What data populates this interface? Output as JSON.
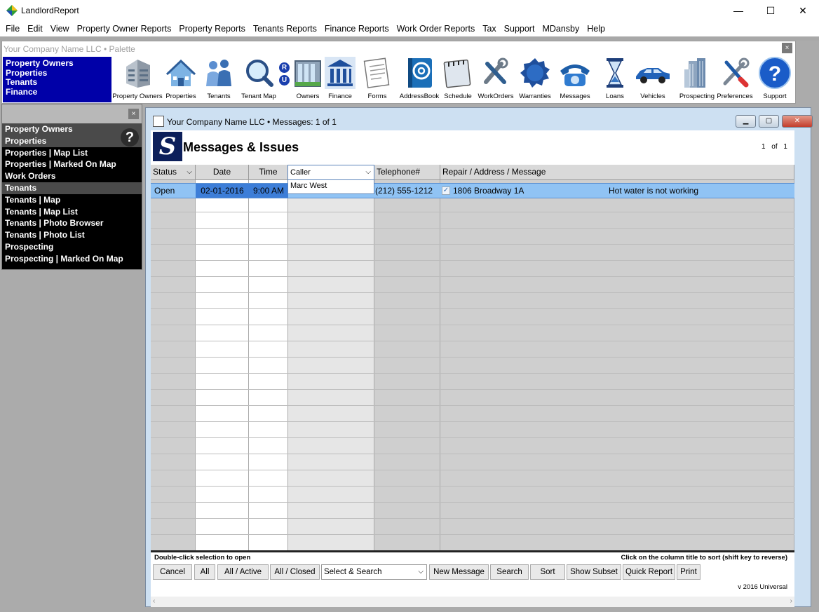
{
  "app": {
    "title": "LandlordReport"
  },
  "window_controls": {
    "minimize": "—",
    "maximize": "☐",
    "close": "✕"
  },
  "menu": [
    "File",
    "Edit",
    "View",
    "Property Owner Reports",
    "Property Reports",
    "Tenants Reports",
    "Finance Reports",
    "Work Order Reports",
    "Tax",
    "Support",
    "MDansby",
    "Help"
  ],
  "palette": {
    "title": "Your Company Name LLC  •  Palette",
    "close": "×",
    "nav": [
      "Property Owners",
      "Properties",
      "Tenants",
      "Finance"
    ],
    "ru": [
      "R",
      "U"
    ],
    "tools": [
      {
        "label": "Property Owners",
        "icon": "building-icon"
      },
      {
        "label": "Properties",
        "icon": "house-icon"
      },
      {
        "label": "Tenants",
        "icon": "people-icon"
      },
      {
        "label": "Tenant Map",
        "icon": "magnifier-icon"
      },
      {
        "label": "Owners",
        "icon": "office-tower-icon"
      },
      {
        "label": "Finance",
        "icon": "bank-icon"
      },
      {
        "label": "Forms",
        "icon": "forms-icon"
      },
      {
        "label": "AddressBook",
        "icon": "address-book-icon"
      },
      {
        "label": "Schedule",
        "icon": "calendar-icon"
      },
      {
        "label": "WorkOrders",
        "icon": "tools-icon"
      },
      {
        "label": "Warranties",
        "icon": "warranty-badge-icon"
      },
      {
        "label": "Messages",
        "icon": "telephone-icon"
      },
      {
        "label": "Loans",
        "icon": "hourglass-icon"
      },
      {
        "label": "Vehicles",
        "icon": "car-icon"
      },
      {
        "label": "Prospecting",
        "icon": "skyscraper-icon"
      },
      {
        "label": "Preferences",
        "icon": "wrench-screwdriver-icon"
      },
      {
        "label": "Support",
        "icon": "help-icon"
      }
    ]
  },
  "sidebar": {
    "close": "×",
    "help": "?",
    "items": [
      {
        "label": "Property Owners",
        "section": true
      },
      {
        "label": "Properties",
        "section": true
      },
      {
        "label": "Properties | Map List",
        "section": false
      },
      {
        "label": "Properties | Marked On Map",
        "section": false
      },
      {
        "label": "Work Orders",
        "section": false
      },
      {
        "label": "Tenants",
        "section": true
      },
      {
        "label": "Tenants | Map",
        "section": false
      },
      {
        "label": "Tenants | Map List",
        "section": false
      },
      {
        "label": "Tenants | Photo Browser",
        "section": false
      },
      {
        "label": "Tenants | Photo List",
        "section": false
      },
      {
        "label": "Prospecting",
        "section": false
      },
      {
        "label": "Prospecting | Marked On Map",
        "section": false
      }
    ]
  },
  "messages_window": {
    "title": "Your Company Name LLC  •  Messages: 1 of 1",
    "logo": "S",
    "heading": "Messages & Issues",
    "page_indicator": "1 of 1",
    "columns": {
      "status": "Status",
      "date": "Date",
      "time": "Time",
      "caller": "Caller",
      "telephone": "Telephone#",
      "repair": "Repair / Address / Message"
    },
    "caller_dropdown": {
      "header": "Caller",
      "options": [
        "Marc West"
      ]
    },
    "rows": [
      {
        "status": "Open",
        "date": "02-01-2016",
        "time": "9:00 AM",
        "caller": "Marc West",
        "telephone": "(212) 555-1212",
        "address": "1806 Broadway 1A",
        "message": "Hot water is not working"
      }
    ],
    "hint_left": "Double-click selection to open",
    "hint_right": "Click on the column title to sort (shift key to reverse)",
    "buttons": {
      "cancel": "Cancel",
      "all": "All",
      "all_active": "All / Active",
      "all_closed": "All / Closed",
      "select_search": "Select & Search",
      "new_message": "New Message",
      "search": "Search",
      "sort": "Sort",
      "show_subset": "Show Subset",
      "quick_report": "Quick Report",
      "print": "Print"
    },
    "version": "v 2016 Universal"
  },
  "colors": {
    "nav_blue": "#0000a8",
    "selection_blue": "#90c3f4",
    "logo_navy": "#0c1f5a"
  }
}
